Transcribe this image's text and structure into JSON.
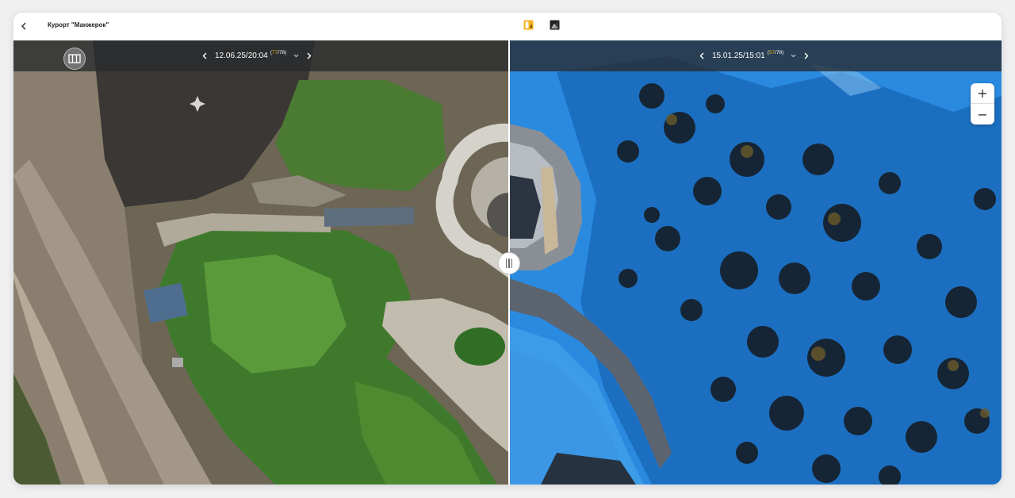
{
  "header": {
    "title": "Курорт \"Манжерок\"",
    "back_icon": "chevron-left-icon",
    "mode_split_icon": "split-view-icon",
    "mode_compare_icon": "compare-view-icon",
    "accent_color": "#f2b21b"
  },
  "left_pane": {
    "date": "12.06.25/20:04",
    "counter_current": "77",
    "counter_total": "/78)",
    "counter_open": "(",
    "layers_icon": "layers-icon",
    "season": "summer"
  },
  "right_pane": {
    "date": "15.01.25/15:01",
    "counter_current": "57",
    "counter_total": "/78)",
    "counter_open": "(",
    "season": "winter"
  },
  "zoom": {
    "in_label": "+",
    "out_label": "−"
  },
  "divider": {
    "handle_icon": "drag-handle-icon"
  }
}
